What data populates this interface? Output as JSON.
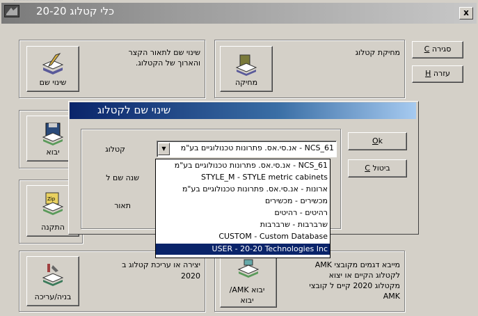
{
  "window": {
    "title": "כלי קטלוג 20-20",
    "close_label": "x"
  },
  "side_buttons": {
    "close": {
      "label": "סגירה",
      "hotkey": "C"
    },
    "help": {
      "label": "עזרה",
      "hotkey": "H"
    }
  },
  "tiles": {
    "rename": {
      "label": "שינוי שם",
      "desc_line1": "שינוי שם לתאור הקצר",
      "desc_line2": "והארוך של הקטלוג."
    },
    "delete": {
      "label": "מחיקה",
      "desc_line1": "מחיקת קטלוג"
    },
    "import": {
      "label": "יבוא"
    },
    "install": {
      "label": "התקנה"
    },
    "build": {
      "label": "בניה/עריכה",
      "desc_line1": "יצירה או עריכת קטלוג ב",
      "desc_line2": "2020"
    },
    "import_amk": {
      "label_line1": "יבוא AMK/",
      "label_line2": "יבוא",
      "desc_line1": "מייבא דגמים מקובצי AMK",
      "desc_line2": "לקטלוג הקיים או יצוא",
      "desc_line3": "מקטלוג 2020 קיים ל קובצי",
      "desc_line4": "AMK"
    }
  },
  "dialog": {
    "title": "שינוי שם לקטלוג",
    "fields": {
      "catalog": "קטלוג",
      "year": "שנה שם ל",
      "desc": "תאור"
    },
    "ok": {
      "label": "k",
      "hotkey": "O"
    },
    "cancel": {
      "label": "ביטול",
      "hotkey": "C"
    },
    "combo_value": "NCS_61 - אנ.סי.אס. פתרונות טכנולוגיים בע\"מ",
    "options": [
      "NCS_61 - אנ.סי.אס. פתרונות טכנולוגיים בע\"מ",
      "STYLE_M - STYLE metric cabinets",
      "ארונות - אנ.סי.אס. פתרונות טכנולוגיים בע\"מ",
      "מכשירים - מכשירים",
      "רהיטים - רהיטים",
      "שרברבות - שרברבות",
      "CUSTOM - Custom Database",
      "USER - 20-20 Technologies Inc"
    ]
  }
}
